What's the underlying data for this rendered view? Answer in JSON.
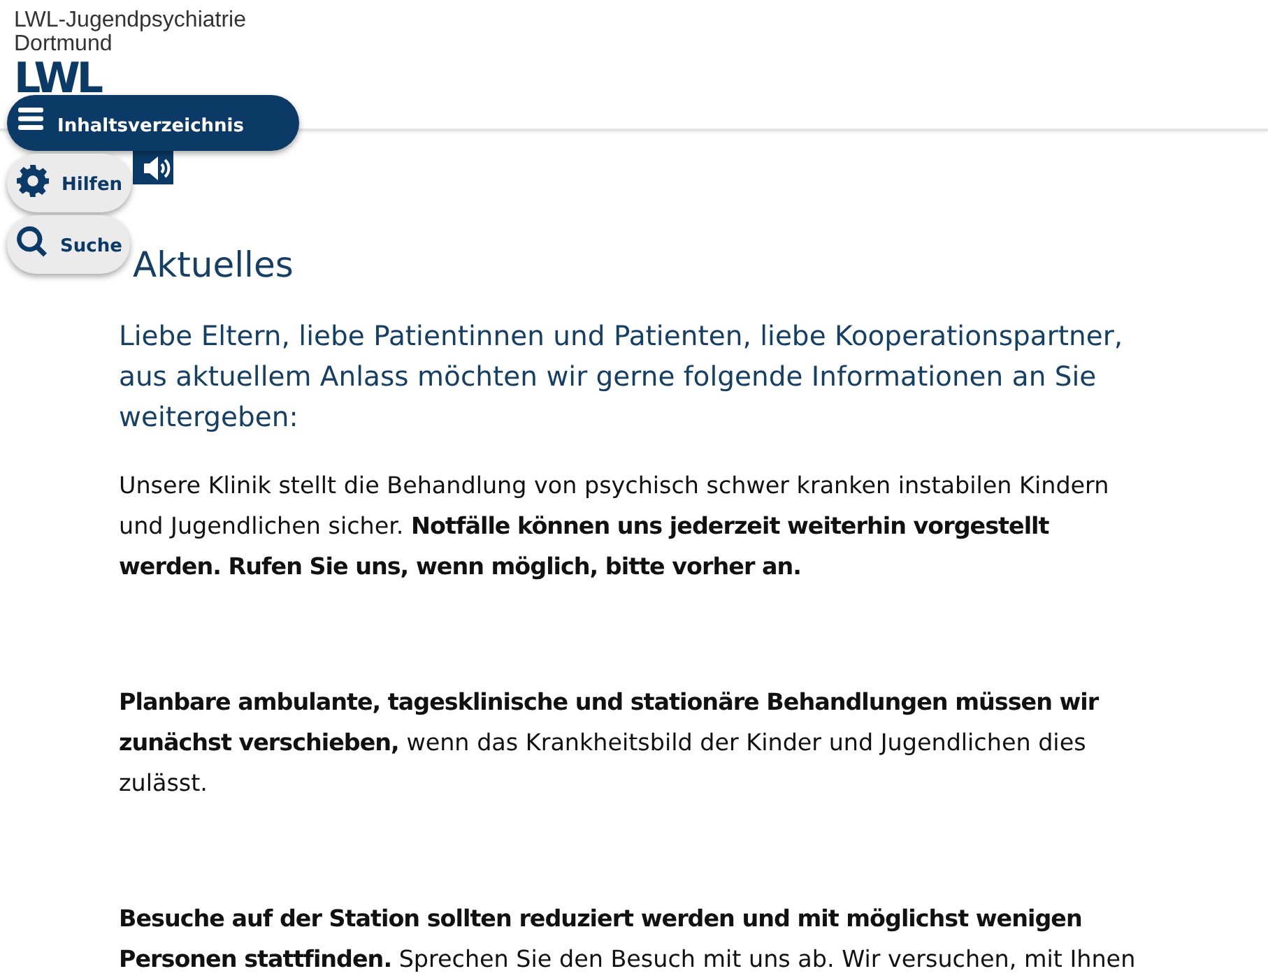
{
  "header": {
    "site_name": "LWL-Jugendpsychiatrie Dortmund",
    "logo": "LWL"
  },
  "nav_buttons": [
    {
      "kind": "menu",
      "label": "Inhaltsverzeichnis"
    },
    {
      "kind": "help",
      "label": "Hilfen"
    },
    {
      "kind": "search",
      "label": "Suche"
    }
  ],
  "article": {
    "title": "Aktuelles",
    "intro": "Liebe Eltern, liebe Patientinnen und Patienten, liebe Kooperationspartner, aus aktuellem Anlass möchten wir gerne folgende Informationen an Sie weitergeben:",
    "paragraphs": [
      "Unsere Klinik stellt die Behandlung von psychisch schwer kranken instabilen Kindern und Jugendlichen sicher. **Notfälle können uns jederzeit weiterhin vorgestellt werden. Rufen Sie uns, wenn möglich, bitte vorher an.**",
      "**Planbare ambulante, tagesklinische und stationäre Behandlungen müssen wir zunächst verschieben,** wenn das Krankheitsbild der Kinder und Jugendlichen dies zulässt.",
      "**Besuche auf der Station sollten reduziert werden und mit möglichst wenigen Personen stattfinden.** Sprechen Sie den Besuch mit uns ab. Wir versuchen, mit Ihnen"
    ]
  }
}
